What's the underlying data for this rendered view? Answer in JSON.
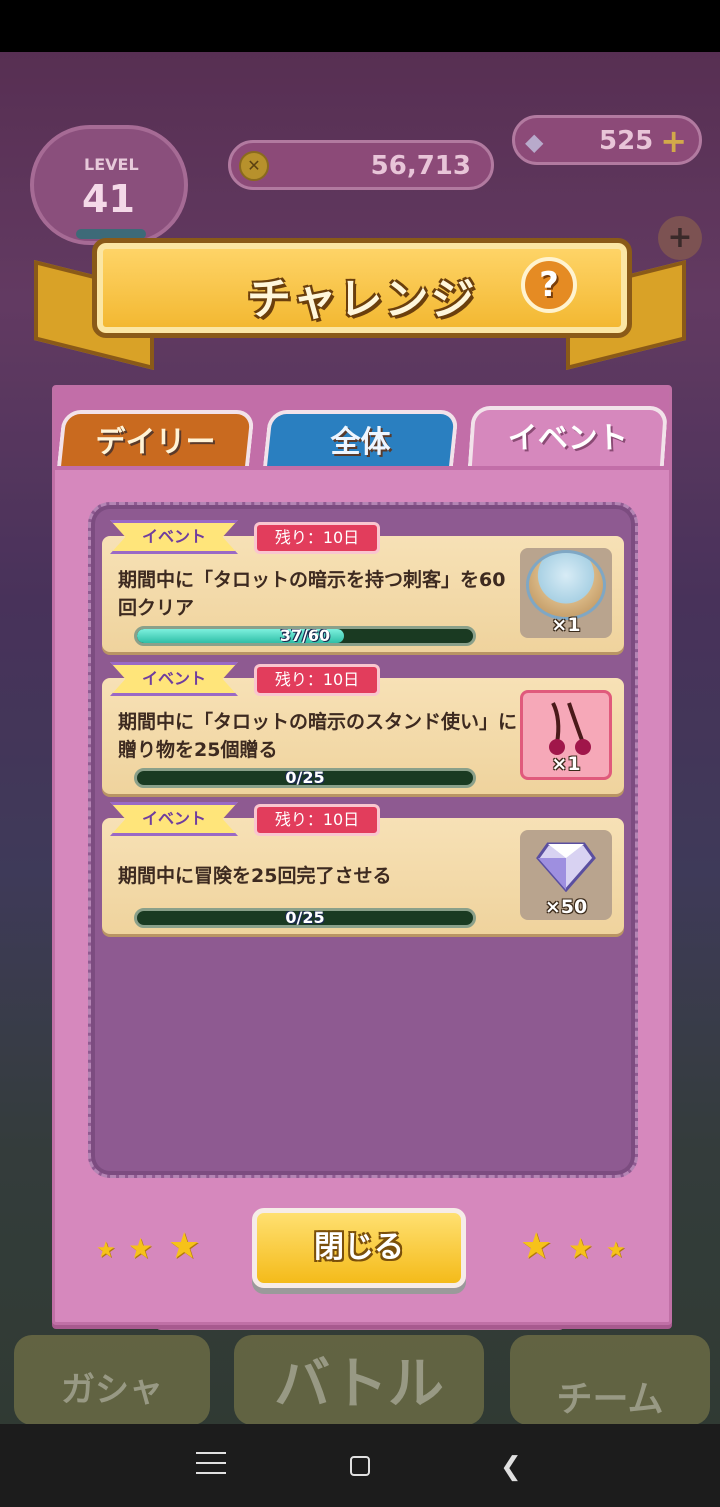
{
  "hud": {
    "level_label": "LEVEL",
    "level": "41",
    "coins": "56,713",
    "gems": "525"
  },
  "dialog": {
    "title": "チャレンジ",
    "help_label": "?",
    "tabs": [
      {
        "label": "デイリー",
        "active": false
      },
      {
        "label": "全体",
        "active": false
      },
      {
        "label": "イベント",
        "active": true
      }
    ],
    "challenges": [
      {
        "tag": "イベント",
        "remaining": "残り：10日",
        "text": "期間中に「タロットの暗示を持つ刺客」を60回クリア",
        "progress_text": "37/60",
        "progress": 0.617,
        "reward_count": "×1",
        "reward_icon": "pyramid-stage-icon"
      },
      {
        "tag": "イベント",
        "remaining": "残り：10日",
        "text": "期間中に「タロットの暗示のスタンド使い」に贈り物を25個贈る",
        "progress_text": "0/25",
        "progress": 0,
        "reward_count": "×1",
        "reward_icon": "cherry-gift-icon"
      },
      {
        "tag": "イベント",
        "remaining": "残り：10日",
        "text": "期間中に冒険を25回完了させる",
        "progress_text": "0/25",
        "progress": 0,
        "reward_count": "×50",
        "reward_icon": "diamond-icon"
      }
    ],
    "close_label": "閉じる"
  },
  "bottom_nav": {
    "gacha": "ガシャ",
    "battle": "バトル",
    "team": "チーム"
  },
  "colors": {
    "dialog_bg": "#d688bd",
    "banner": "#f2b62e",
    "progress_fill": "#2fbfa7",
    "remaining_badge": "#e23d5c"
  }
}
